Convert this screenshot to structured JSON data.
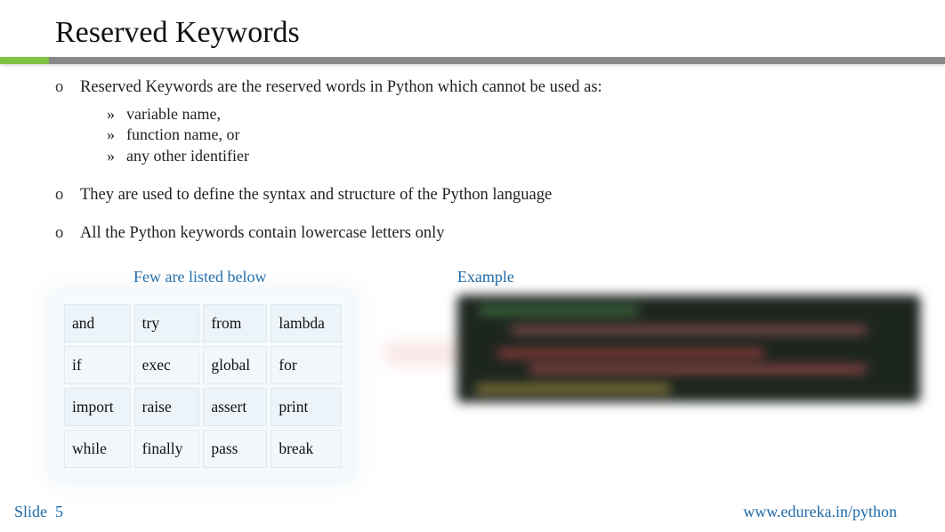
{
  "title": "Reserved Keywords",
  "bullets": {
    "b1": "Reserved Keywords are the reserved words in Python which cannot be used as:",
    "subs": {
      "s1": "variable name,",
      "s2": "function name, or",
      "s3": "any other identifier"
    },
    "b2": "They are used to define the syntax and structure of the Python language",
    "b3": "All the Python keywords contain lowercase letters only"
  },
  "table_heading": "Few are listed below",
  "example_heading": "Example",
  "table": {
    "r0": {
      "c0": "and",
      "c1": "try",
      "c2": "from",
      "c3": "lambda"
    },
    "r1": {
      "c0": "if",
      "c1": "exec",
      "c2": "global",
      "c3": "for"
    },
    "r2": {
      "c0": "import",
      "c1": "raise",
      "c2": "assert",
      "c3": "print"
    },
    "r3": {
      "c0": "while",
      "c1": "finally",
      "c2": "pass",
      "c3": "break"
    }
  },
  "footer": {
    "slide_label": "Slide",
    "slide_num": "5",
    "url": "www.edureka.in/python"
  },
  "markers": {
    "circle": "o",
    "dbl": "»"
  }
}
